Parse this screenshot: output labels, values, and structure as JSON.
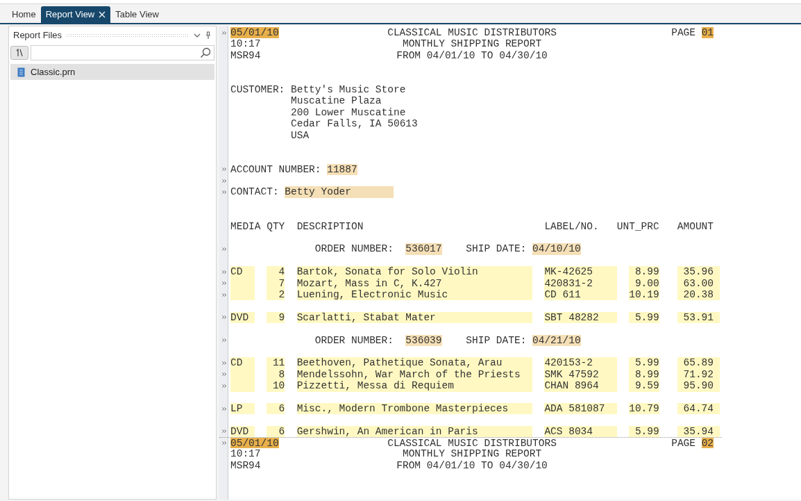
{
  "tabs": [
    {
      "label": "Home",
      "selected": false
    },
    {
      "label": "Report View",
      "selected": true
    },
    {
      "label": "Table View",
      "selected": false
    }
  ],
  "file_panel": {
    "title": "Report Files",
    "files": [
      {
        "name": "Classic.prn",
        "selected": true
      }
    ]
  },
  "report": {
    "pages": [
      {
        "header": {
          "marked": true,
          "date": "05/01/10",
          "title": "CLASSICAL MUSIC DISTRIBUTORS",
          "page_label": "PAGE",
          "page_number": "01",
          "time": "10:17",
          "subtitle": "MONTHLY SHIPPING REPORT",
          "code": "MSR94",
          "range": "FROM 04/01/10 TO 04/30/10"
        },
        "customer": {
          "label": "CUSTOMER:",
          "lines": [
            "Betty's Music Store",
            "Muscatine Plaza",
            "200 Lower Muscatine",
            "Cedar Falls, IA 50613",
            "USA"
          ]
        },
        "account": {
          "marked": true,
          "gap_marked": true,
          "label": "ACCOUNT NUMBER:",
          "value": "11887"
        },
        "contact": {
          "marked": true,
          "label": "CONTACT:",
          "value": "Betty Yoder"
        },
        "columns": [
          "MEDIA",
          "QTY",
          "DESCRIPTION",
          "LABEL/NO.",
          "UNT_PRC",
          "AMOUNT"
        ],
        "orders": [
          {
            "marked": true,
            "label": "ORDER NUMBER:",
            "number": "536017",
            "ship_label": "SHIP DATE:",
            "ship_date": "04/10/10",
            "groups": [
              {
                "media": "CD",
                "items": [
                  {
                    "marked": true,
                    "qty": "4",
                    "description": "Bartok, Sonata for Solo Violin",
                    "label_no": "MK-42625",
                    "unit_price": "8.99",
                    "amount": "35.96"
                  },
                  {
                    "marked": true,
                    "qty": "7",
                    "description": "Mozart, Mass in C, K.427",
                    "label_no": "420831-2",
                    "unit_price": "9.00",
                    "amount": "63.00"
                  },
                  {
                    "marked": true,
                    "qty": "2",
                    "description": "Luening, Electronic Music",
                    "label_no": "CD 611",
                    "unit_price": "10.19",
                    "amount": "20.38"
                  }
                ]
              },
              {
                "media": "DVD",
                "items": [
                  {
                    "marked": true,
                    "qty": "9",
                    "description": "Scarlatti, Stabat Mater",
                    "label_no": "SBT 48282",
                    "unit_price": "5.99",
                    "amount": "53.91"
                  }
                ]
              }
            ]
          },
          {
            "marked": true,
            "label": "ORDER NUMBER:",
            "number": "536039",
            "ship_label": "SHIP DATE:",
            "ship_date": "04/21/10",
            "groups": [
              {
                "media": "CD",
                "items": [
                  {
                    "marked": true,
                    "qty": "11",
                    "description": "Beethoven, Pathetique Sonata, Arau",
                    "label_no": "420153-2",
                    "unit_price": "5.99",
                    "amount": "65.89"
                  },
                  {
                    "marked": true,
                    "qty": "8",
                    "description": "Mendelssohn, War March of the Priests",
                    "label_no": "SMK 47592",
                    "unit_price": "8.99",
                    "amount": "71.92"
                  },
                  {
                    "marked": true,
                    "qty": "10",
                    "description": "Pizzetti, Messa di Requiem",
                    "label_no": "CHAN 8964",
                    "unit_price": "9.59",
                    "amount": "95.90"
                  }
                ]
              },
              {
                "media": "LP",
                "items": [
                  {
                    "marked": true,
                    "qty": "6",
                    "description": "Misc., Modern Trombone Masterpieces",
                    "label_no": "ADA 581087",
                    "unit_price": "10.79",
                    "amount": "64.74"
                  }
                ]
              },
              {
                "media": "DVD",
                "items": [
                  {
                    "marked": true,
                    "qty": "6",
                    "description": "Gershwin, An American in Paris",
                    "label_no": "ACS 8034",
                    "unit_price": "5.99",
                    "amount": "35.94"
                  }
                ]
              }
            ]
          }
        ]
      },
      {
        "header": {
          "marked": true,
          "date": "05/01/10",
          "title": "CLASSICAL MUSIC DISTRIBUTORS",
          "page_label": "PAGE",
          "page_number": "02",
          "time": "10:17",
          "subtitle": "MONTHLY SHIPPING REPORT",
          "code": "MSR94",
          "range": "FROM 04/01/10 TO 04/30/10"
        }
      }
    ]
  }
}
